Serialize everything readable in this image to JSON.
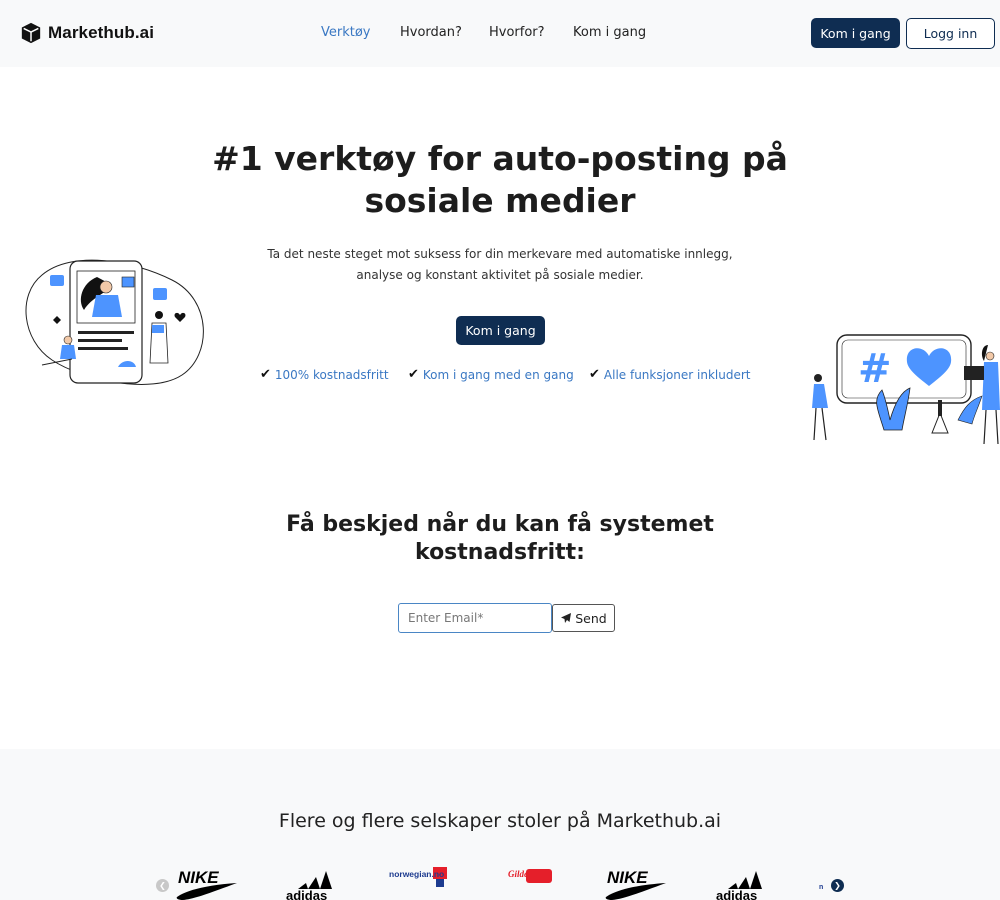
{
  "nav": {
    "brand": "Markethub.ai",
    "links": [
      "Verktøy",
      "Hvordan?",
      "Hvorfor?",
      "Kom i gang"
    ],
    "cta_primary": "Kom i gang",
    "cta_login": "Logg inn"
  },
  "hero": {
    "title": "#1 verktøy for auto-posting på sosiale medier",
    "subtitle": "Ta det neste steget mot suksess for din merkevare med automatiske innlegg, analyse og konstant aktivitet på sosiale medier.",
    "cta": "Kom i gang",
    "features": [
      "100% kostnadsfritt",
      "Kom i gang med en gang",
      "Alle funksjoner inkludert"
    ]
  },
  "notify": {
    "title": "Få beskjed når du kan få systemet kostnadsfritt:",
    "email_placeholder": "Enter Email*",
    "send_label": "Send"
  },
  "trust": {
    "title": "Flere og flere selskaper stoler på Markethub.ai",
    "logos": [
      "NIKE",
      "adidas",
      "norwegian.no",
      "Gilde",
      "NIKE",
      "adidas",
      "n"
    ]
  },
  "colors": {
    "navy": "#0f2d52",
    "link_blue": "#3a78c3",
    "illustration_blue": "#4d94ff"
  }
}
